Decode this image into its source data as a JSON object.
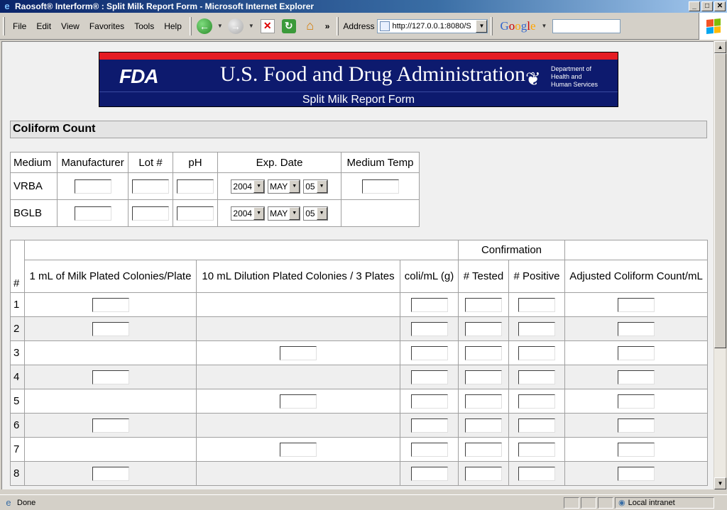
{
  "window": {
    "title": "Raosoft® Interform® : Split Milk Report Form - Microsoft Internet Explorer"
  },
  "menu": [
    "File",
    "Edit",
    "View",
    "Favorites",
    "Tools",
    "Help"
  ],
  "toolbar": {
    "address_label": "Address",
    "address_value": "http://127.0.0.1:8080/S",
    "google": "Google",
    "chevron": "»"
  },
  "banner": {
    "logo": "FDA",
    "agency": "U.S. Food and Drug Administration",
    "hhs_line1": "Department of",
    "hhs_line2": "Health and",
    "hhs_line3": "Human Services",
    "subtitle": "Split Milk Report Form"
  },
  "section": {
    "title": "Coliform Count"
  },
  "media_table": {
    "headers": [
      "Medium",
      "Manufacturer",
      "Lot #",
      "pH",
      "Exp. Date",
      "Medium Temp"
    ],
    "rows": [
      {
        "medium": "VRBA",
        "year": "2004",
        "month": "MAY",
        "day": "05"
      },
      {
        "medium": "BGLB",
        "year": "2004",
        "month": "MAY",
        "day": "05"
      }
    ]
  },
  "count_table": {
    "group_header": "Confirmation",
    "headers": {
      "num": "#",
      "milk_plated": "1 mL of Milk Plated Colonies/Plate",
      "dilution_plated": "10 mL Dilution Plated Colonies / 3 Plates",
      "coli": "coli/mL (g)",
      "tested": "# Tested",
      "positive": "# Positive",
      "adjusted": "Adjusted Coliform Count/mL"
    },
    "rows": [
      {
        "n": "1",
        "type": "milk"
      },
      {
        "n": "2",
        "type": "milk"
      },
      {
        "n": "3",
        "type": "dilution"
      },
      {
        "n": "4",
        "type": "milk"
      },
      {
        "n": "5",
        "type": "dilution"
      },
      {
        "n": "6",
        "type": "milk"
      },
      {
        "n": "7",
        "type": "dilution"
      },
      {
        "n": "8",
        "type": "milk"
      }
    ]
  },
  "status": {
    "message": "Done",
    "zone": "Local intranet"
  }
}
